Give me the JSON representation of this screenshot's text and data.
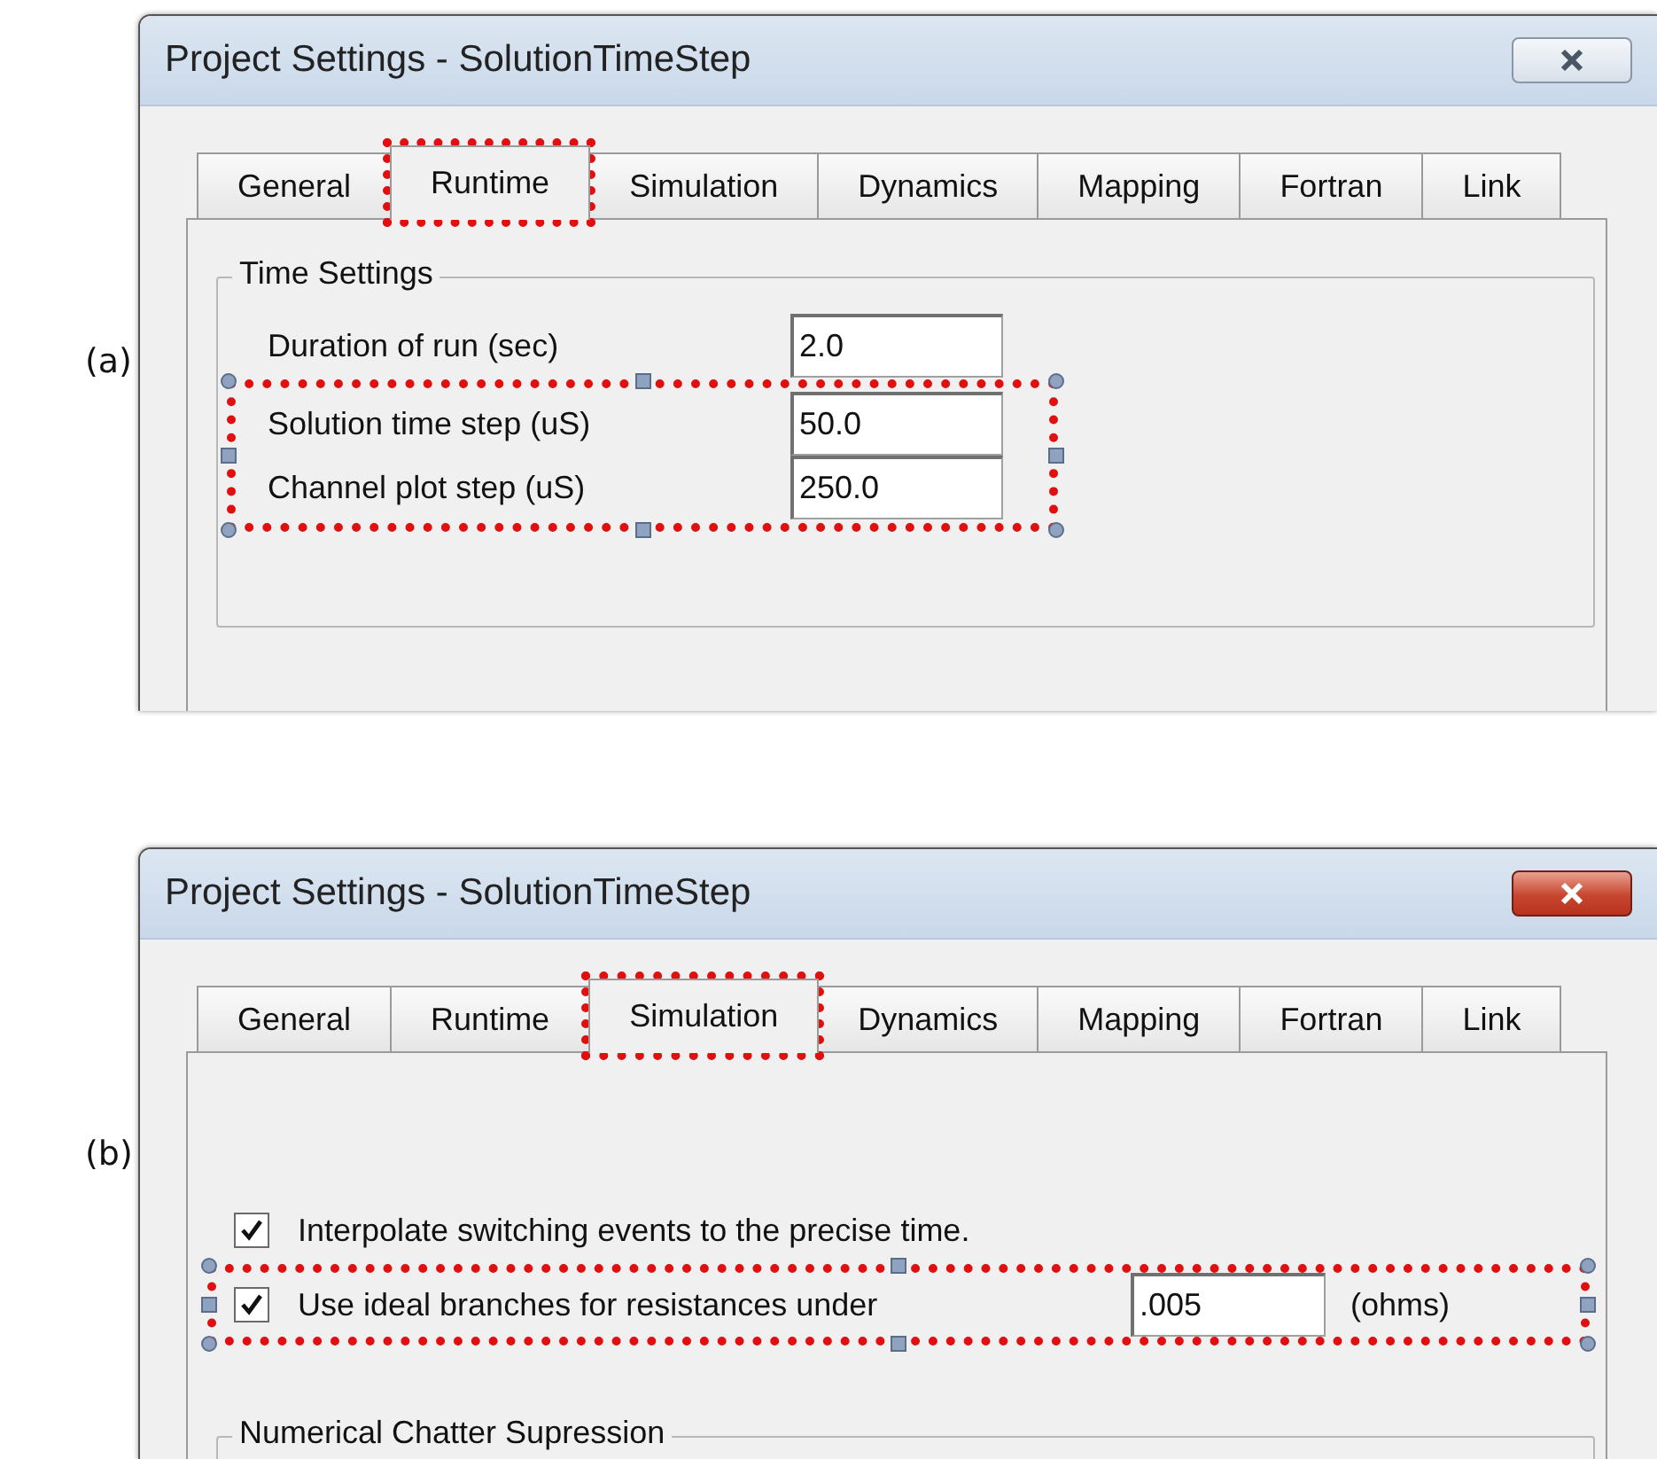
{
  "panels": [
    {
      "label": "(a)",
      "dialog": {
        "title": "Project Settings - SolutionTimeStep",
        "close_button": {
          "active": false
        },
        "tabs": [
          {
            "label": "General",
            "selected": false,
            "highlighted": false
          },
          {
            "label": "Runtime",
            "selected": true,
            "highlighted": true
          },
          {
            "label": "Simulation",
            "selected": false,
            "highlighted": false
          },
          {
            "label": "Dynamics",
            "selected": false,
            "highlighted": false
          },
          {
            "label": "Mapping",
            "selected": false,
            "highlighted": false
          },
          {
            "label": "Fortran",
            "selected": false,
            "highlighted": false
          },
          {
            "label": "Link",
            "selected": false,
            "highlighted": false
          }
        ],
        "content": {
          "kind": "runtime",
          "group": "Time Settings",
          "rows": [
            {
              "label": "Duration of run (sec)",
              "value": "2.0",
              "highlighted": false
            },
            {
              "label": "Solution time step (uS)",
              "value": "50.0",
              "highlighted": true
            },
            {
              "label": "Channel plot step (uS)",
              "value": "250.0",
              "highlighted": true
            }
          ]
        }
      }
    },
    {
      "label": "(b)",
      "dialog": {
        "title": "Project Settings - SolutionTimeStep",
        "close_button": {
          "active": true
        },
        "tabs": [
          {
            "label": "General",
            "selected": false,
            "highlighted": false
          },
          {
            "label": "Runtime",
            "selected": false,
            "highlighted": false
          },
          {
            "label": "Simulation",
            "selected": true,
            "highlighted": true
          },
          {
            "label": "Dynamics",
            "selected": false,
            "highlighted": false
          },
          {
            "label": "Mapping",
            "selected": false,
            "highlighted": false
          },
          {
            "label": "Fortran",
            "selected": false,
            "highlighted": false
          },
          {
            "label": "Link",
            "selected": false,
            "highlighted": false
          }
        ],
        "content": {
          "kind": "simulation",
          "rows": [
            {
              "label": "Interpolate switching events to the precise time.",
              "checked": true,
              "highlighted": false
            },
            {
              "label": "Use ideal branches for resistances under",
              "checked": true,
              "value": ".005",
              "unit": "(ohms)",
              "highlighted": true
            }
          ],
          "group": "Numerical Chatter Supression"
        }
      }
    }
  ]
}
